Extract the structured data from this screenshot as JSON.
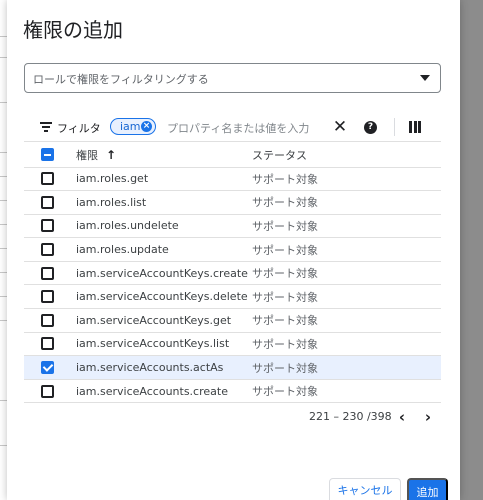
{
  "dialog": {
    "title": "権限の追加",
    "role_select_placeholder": "ロールで権限をフィルタリングする"
  },
  "filter_bar": {
    "filter_label": "フィルタ",
    "chip_label": "iam",
    "input_placeholder": "プロパティ名または値を入力",
    "clear_icon": "close-icon",
    "help_icon": "help-icon",
    "columns_icon": "column-display-icon"
  },
  "table": {
    "header_checkbox_state": "indeterminate",
    "columns": {
      "permission": "権限",
      "status": "ステータス"
    },
    "sort": "ascending",
    "rows": [
      {
        "permission": "iam.roles.get",
        "status": "サポート対象",
        "checked": false
      },
      {
        "permission": "iam.roles.list",
        "status": "サポート対象",
        "checked": false
      },
      {
        "permission": "iam.roles.undelete",
        "status": "サポート対象",
        "checked": false
      },
      {
        "permission": "iam.roles.update",
        "status": "サポート対象",
        "checked": false
      },
      {
        "permission": "iam.serviceAccountKeys.create",
        "status": "サポート対象",
        "checked": false
      },
      {
        "permission": "iam.serviceAccountKeys.delete",
        "status": "サポート対象",
        "checked": false
      },
      {
        "permission": "iam.serviceAccountKeys.get",
        "status": "サポート対象",
        "checked": false
      },
      {
        "permission": "iam.serviceAccountKeys.list",
        "status": "サポート対象",
        "checked": false
      },
      {
        "permission": "iam.serviceAccounts.actAs",
        "status": "サポート対象",
        "checked": true
      },
      {
        "permission": "iam.serviceAccounts.create",
        "status": "サポート対象",
        "checked": false
      }
    ]
  },
  "pagination": {
    "range_text": "221 – 230 /398"
  },
  "actions": {
    "cancel_label": "キャンセル",
    "add_label": "追加"
  },
  "colors": {
    "accent": "#1a73e8",
    "selected_row": "#e8f0fe"
  }
}
